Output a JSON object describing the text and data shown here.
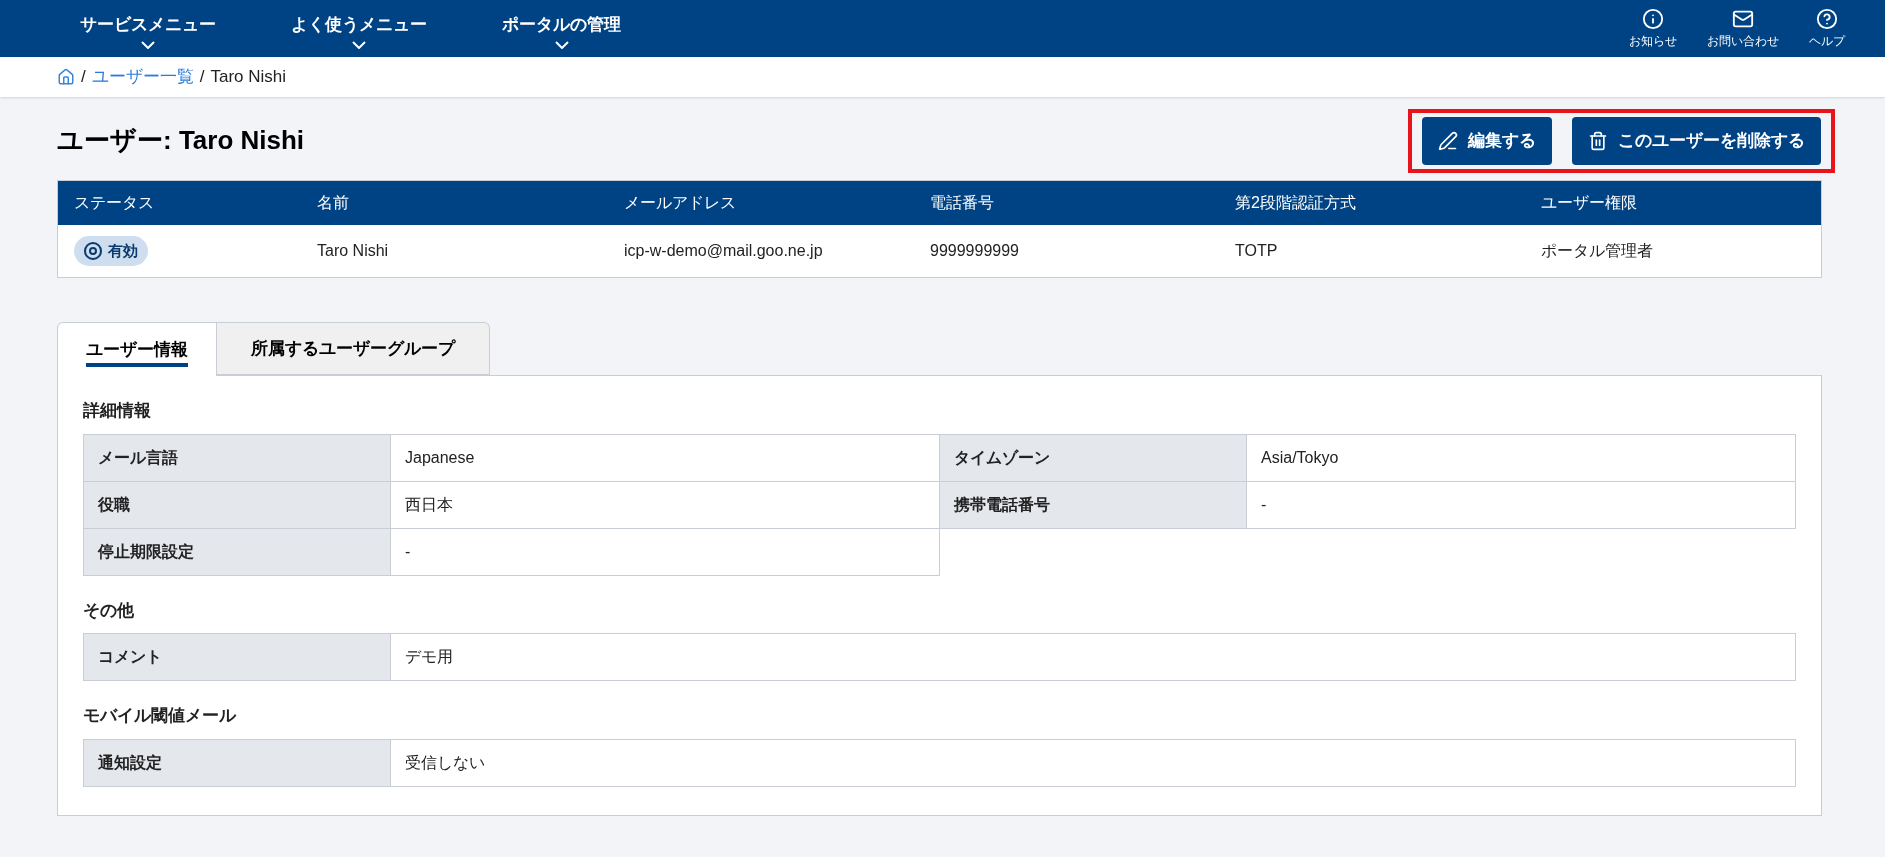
{
  "nav": {
    "menus": [
      {
        "label": "サービスメニュー"
      },
      {
        "label": "よく使うメニュー"
      },
      {
        "label": "ポータルの管理"
      }
    ],
    "utilities": [
      {
        "kind": "info",
        "label": "お知らせ"
      },
      {
        "kind": "mail",
        "label": "お問い合わせ"
      },
      {
        "kind": "help",
        "label": "ヘルプ"
      }
    ]
  },
  "breadcrumb": [
    {
      "kind": "separator",
      "text": "/"
    },
    {
      "kind": "link",
      "text": "ユーザー一覧"
    },
    {
      "kind": "separator",
      "text": "/"
    },
    {
      "kind": "current",
      "text": "Taro Nishi"
    }
  ],
  "page_title": "ユーザー: Taro Nishi",
  "actions": [
    {
      "kind": "edit",
      "label": "編集する"
    },
    {
      "kind": "delete",
      "label": "このユーザーを削除する"
    }
  ],
  "summary": {
    "columns": [
      "ステータス",
      "名前",
      "メールアドレス",
      "電話番号",
      "第2段階認証方式",
      "ユーザー権限"
    ],
    "row": {
      "status": "有効",
      "name": "Taro Nishi",
      "email": "icp-w-demo@mail.goo.ne.jp",
      "phone": "9999999999",
      "mfa": "TOTP",
      "role": "ポータル管理者"
    }
  },
  "tabs": [
    {
      "label": "ユーザー情報",
      "selected": true
    },
    {
      "label": "所属するユーザーグループ",
      "selected": false
    }
  ],
  "sections": [
    {
      "title": "詳細情報",
      "kind": "two_column",
      "fields": [
        {
          "label": "メール言語",
          "value": "Japanese"
        },
        {
          "label": "タイムゾーン",
          "value": "Asia/Tokyo"
        },
        {
          "label": "役職",
          "value": "西日本"
        },
        {
          "label": "携帯電話番号",
          "value": "-"
        },
        {
          "label": "停止期限設定",
          "value": "-"
        }
      ]
    },
    {
      "title": "その他",
      "kind": "single_column",
      "fields": [
        {
          "label": "コメント",
          "value": "デモ用"
        }
      ]
    },
    {
      "title": "モバイル閾値メール",
      "kind": "single_column",
      "fields": [
        {
          "label": "通知設定",
          "value": "受信しない"
        }
      ]
    }
  ]
}
